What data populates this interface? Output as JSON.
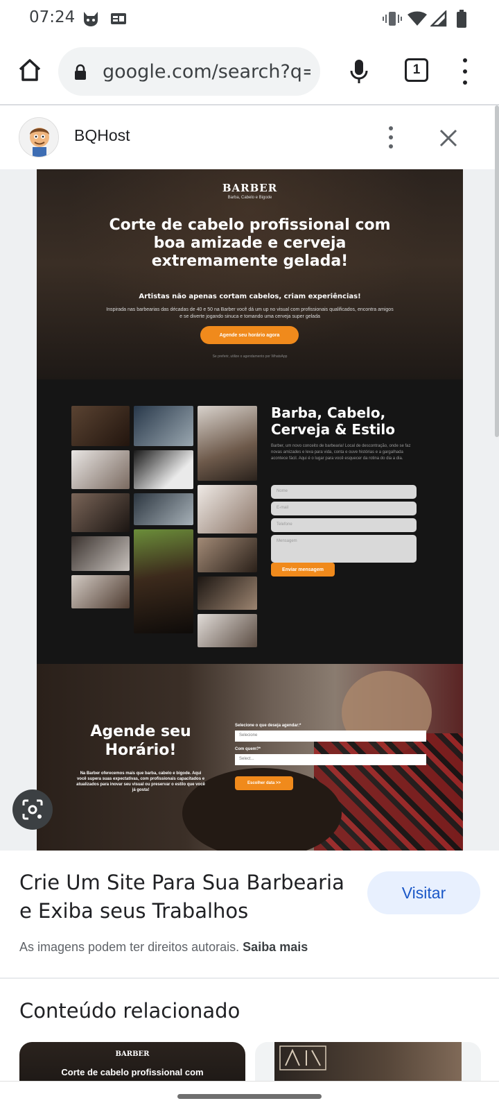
{
  "status_bar": {
    "time": "07:24",
    "icons": [
      "notification-cat-icon",
      "id-card-icon",
      "vibrate-icon",
      "wifi-icon",
      "signal-icon",
      "battery-icon"
    ]
  },
  "browser": {
    "url": "google.com/search?q=w",
    "tab_count": "1",
    "icons": [
      "home-icon",
      "lock-icon",
      "mic-icon",
      "tabs-icon",
      "more-vert-icon"
    ]
  },
  "panel": {
    "site_name": "BQHost",
    "icons": [
      "site-avatar-icon",
      "more-vert-icon",
      "close-icon",
      "lens-icon"
    ]
  },
  "image_content": {
    "hero": {
      "brand": "BARBER",
      "brand_sub": "Barba, Cabelo e Bigode",
      "title": "Corte de cabelo profissional com boa amizade e cerveja extremamente gelada!",
      "subtitle": "Artistas não apenas cortam cabelos, criam experiências!",
      "description": "Inspirada nas barbearias das décadas de 40 e 50 na Barber você dá um up no visual com profissionais qualificados, encontra amigos e se diverte jogando sinuca e tomando uma cerveja super gelada",
      "cta": "Agende seu horário agora",
      "note": "Se preferir, utilize o agendamento por WhatsApp"
    },
    "contact": {
      "title": "Barba, Cabelo, Cerveja & Estilo",
      "description": "Barber, um novo conceito de barbearia! Local de descontração, onde se faz novas amizades e leva para vida, conta e ouve histórias e a gargalhada acontece fácil. Aqui é o lugar para você esquecer da rotina do dia a dia.",
      "fields": [
        "Nome",
        "E-mail",
        "Telefone",
        "Mensagem"
      ],
      "submit": "Enviar mensagem"
    },
    "schedule": {
      "title": "Agende seu Horário!",
      "description": "Na Barber oferecemos mais que barba, cabelo e bigode. Aqui você supera suas expectativas, com profissionais capacitados e atualizados para inovar seu visual ou preservar o estilo que você já gosta!",
      "label_service": "Selecione o que deseja agendar:*",
      "select_service": "Selecione",
      "label_who": "Com quem?*",
      "select_who": "Select...",
      "button": "Escolher data >>"
    }
  },
  "result": {
    "title": "Crie Um Site Para Sua Barbearia e Exiba seus Trabalhos",
    "visit_label": "Visitar",
    "copyright_text": "As imagens podem ter direitos autorais.",
    "learn_more": "Saiba mais"
  },
  "related": {
    "heading": "Conteúdo relacionado",
    "items": [
      {
        "brand": "BARBER",
        "title": "Corte de cabelo profissional com"
      },
      {
        "brand": ""
      }
    ]
  },
  "colors": {
    "accent_orange": "#f08a1c",
    "visit_bg": "#e8f0fe",
    "visit_text": "#1a57c7"
  }
}
